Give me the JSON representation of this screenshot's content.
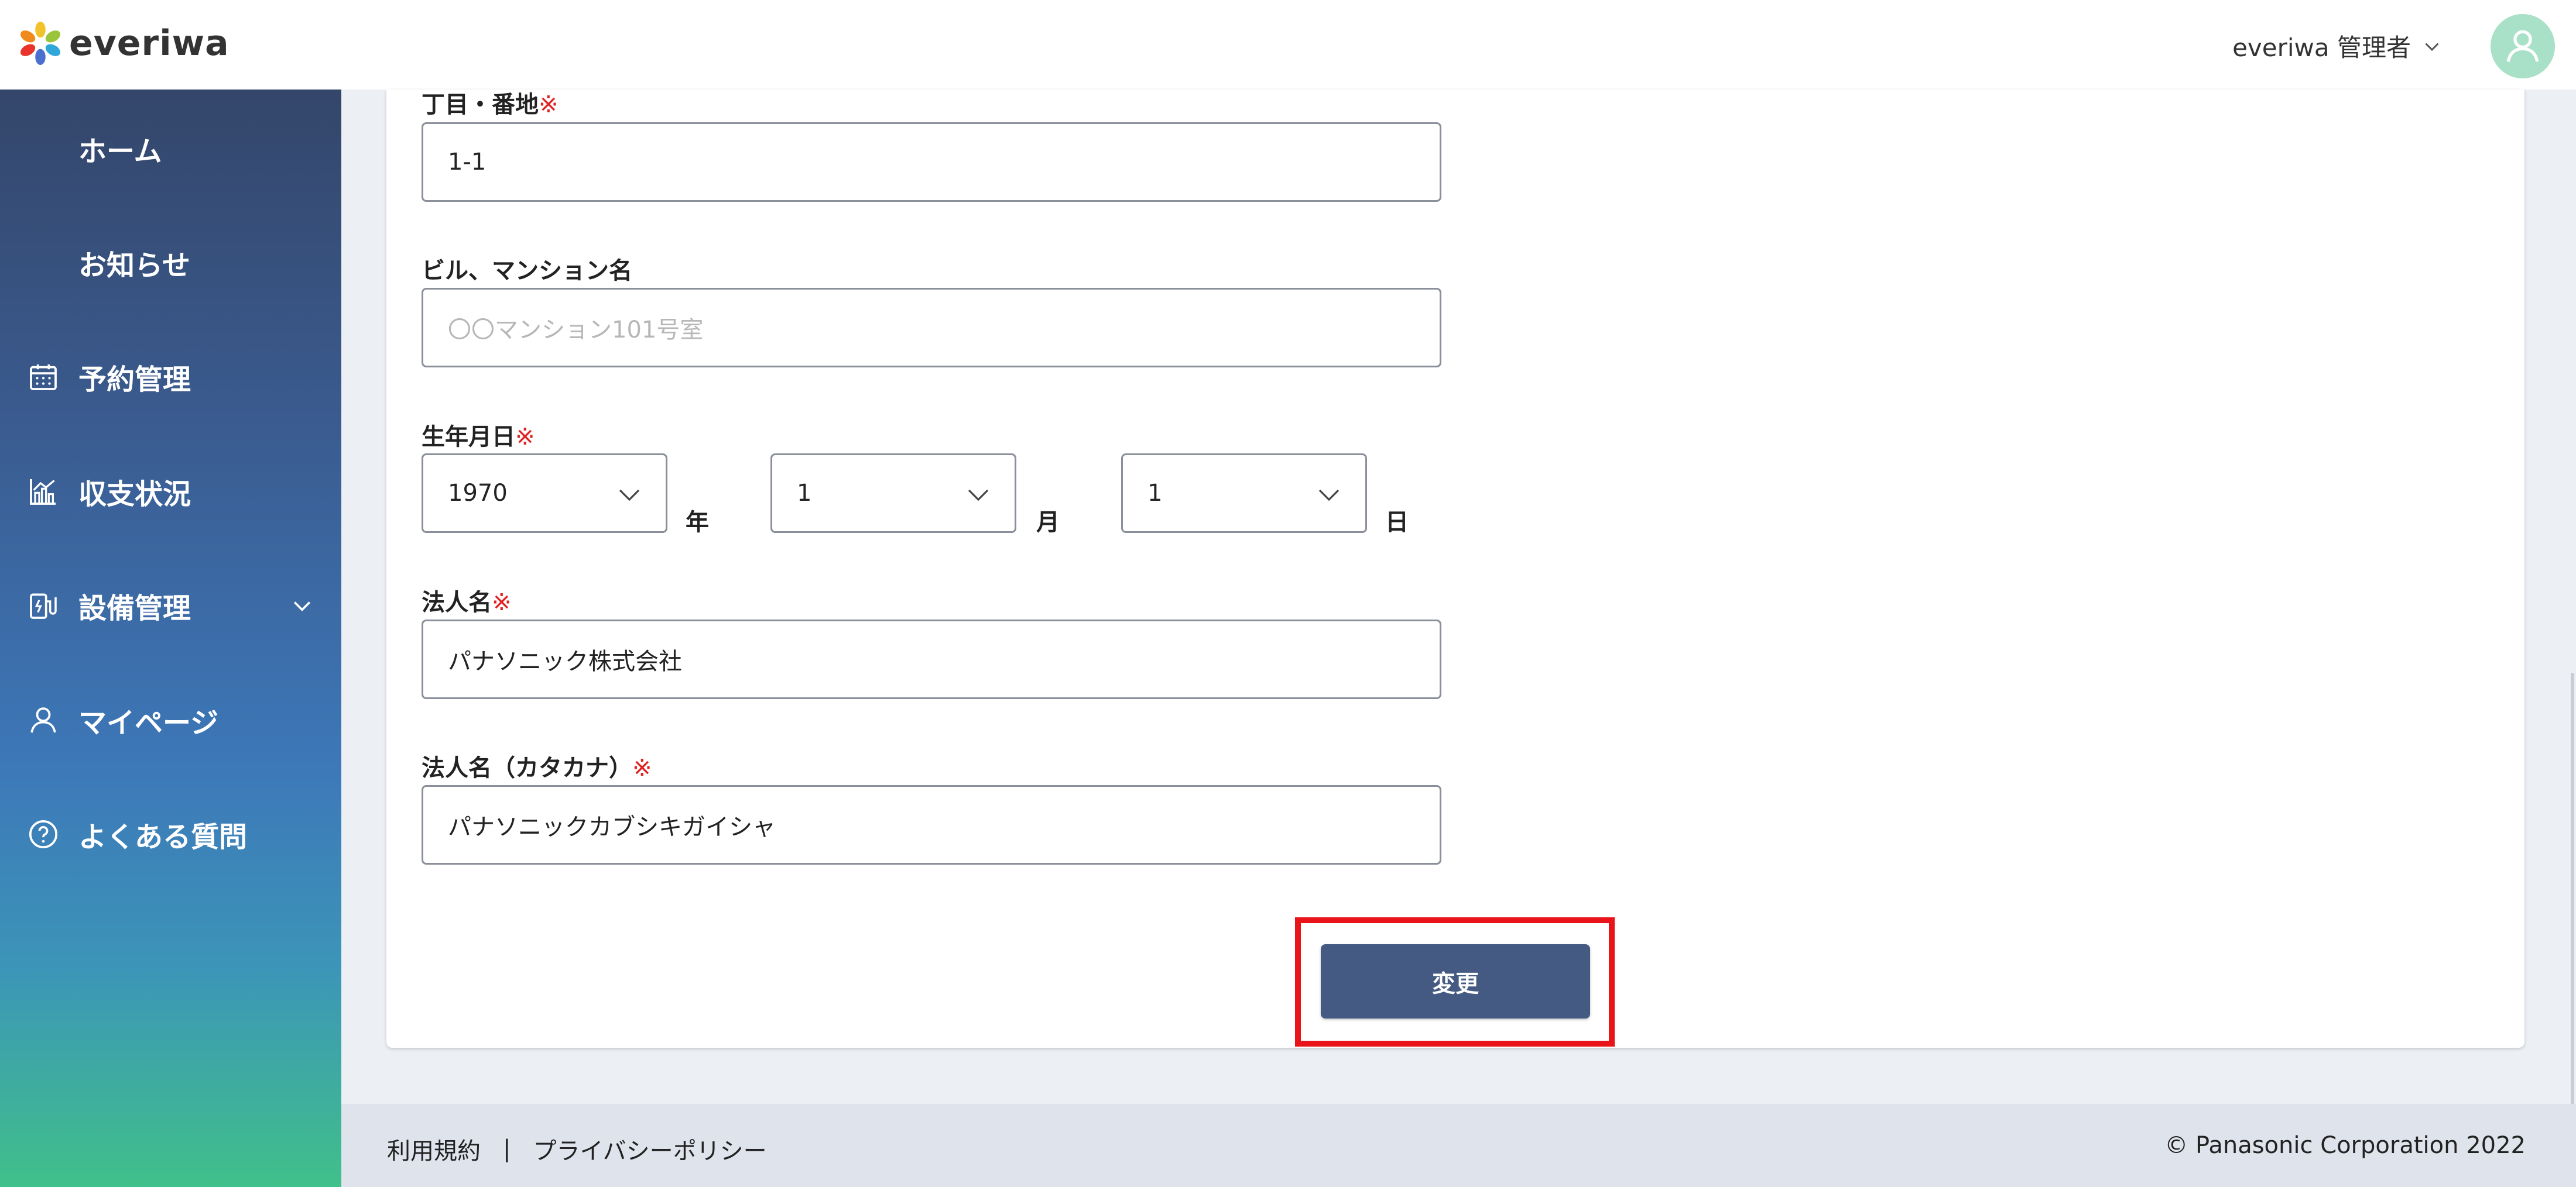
{
  "header": {
    "logo_text": "everiwa",
    "user_name": "everiwa 管理者",
    "icons": [
      "everiwa-logo",
      "chevron-down-icon",
      "user-avatar-icon"
    ]
  },
  "sidebar": {
    "items": [
      {
        "label": "ホーム",
        "icon": null
      },
      {
        "label": "お知らせ",
        "icon": null
      },
      {
        "label": "予約管理",
        "icon": "calendar-icon"
      },
      {
        "label": "収支状況",
        "icon": "chart-icon"
      },
      {
        "label": "設備管理",
        "icon": "charger-icon",
        "expandable": true
      },
      {
        "label": "マイページ",
        "icon": "person-icon"
      },
      {
        "label": "よくある質問",
        "icon": "question-icon"
      }
    ]
  },
  "form": {
    "required_mark": "※",
    "block": {
      "label": "丁目・番地",
      "value": "1-1"
    },
    "building": {
      "label": "ビル、マンション名",
      "value": "",
      "placeholder": "〇〇マンション101号室"
    },
    "birthday": {
      "label": "生年月日",
      "year": "1970",
      "year_unit": "年",
      "month": "1",
      "month_unit": "月",
      "day": "1",
      "day_unit": "日"
    },
    "company": {
      "label": "法人名",
      "value": "パナソニック株式会社"
    },
    "company_kana": {
      "label": "法人名（カタカナ）",
      "value": "パナソニックカブシキガイシャ"
    },
    "submit_label": "変更"
  },
  "footer": {
    "terms": "利用規約",
    "separator": "|",
    "privacy": "プライバシーポリシー",
    "copyright": "© Panasonic Corporation 2022"
  },
  "colors": {
    "button": "#455a82",
    "highlight": "#e8141a",
    "required": "#e02020",
    "sidebar_top": "#34466a",
    "sidebar_bottom": "#40c08a"
  }
}
